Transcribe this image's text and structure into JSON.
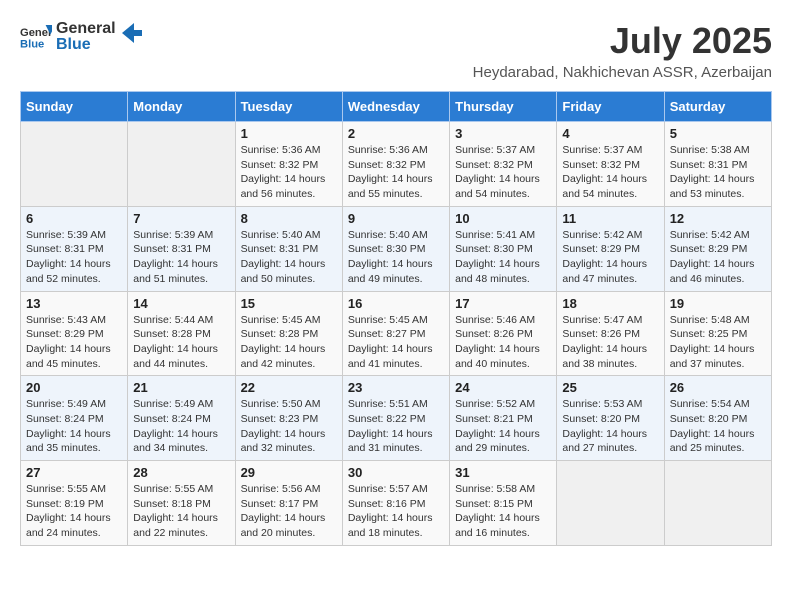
{
  "header": {
    "logo_general": "General",
    "logo_blue": "Blue",
    "month": "July 2025",
    "location": "Heydarabad, Nakhichevan ASSR, Azerbaijan"
  },
  "days_of_week": [
    "Sunday",
    "Monday",
    "Tuesday",
    "Wednesday",
    "Thursday",
    "Friday",
    "Saturday"
  ],
  "weeks": [
    [
      {
        "day": "",
        "info": ""
      },
      {
        "day": "",
        "info": ""
      },
      {
        "day": "1",
        "info": "Sunrise: 5:36 AM\nSunset: 8:32 PM\nDaylight: 14 hours and 56 minutes."
      },
      {
        "day": "2",
        "info": "Sunrise: 5:36 AM\nSunset: 8:32 PM\nDaylight: 14 hours and 55 minutes."
      },
      {
        "day": "3",
        "info": "Sunrise: 5:37 AM\nSunset: 8:32 PM\nDaylight: 14 hours and 54 minutes."
      },
      {
        "day": "4",
        "info": "Sunrise: 5:37 AM\nSunset: 8:32 PM\nDaylight: 14 hours and 54 minutes."
      },
      {
        "day": "5",
        "info": "Sunrise: 5:38 AM\nSunset: 8:31 PM\nDaylight: 14 hours and 53 minutes."
      }
    ],
    [
      {
        "day": "6",
        "info": "Sunrise: 5:39 AM\nSunset: 8:31 PM\nDaylight: 14 hours and 52 minutes."
      },
      {
        "day": "7",
        "info": "Sunrise: 5:39 AM\nSunset: 8:31 PM\nDaylight: 14 hours and 51 minutes."
      },
      {
        "day": "8",
        "info": "Sunrise: 5:40 AM\nSunset: 8:31 PM\nDaylight: 14 hours and 50 minutes."
      },
      {
        "day": "9",
        "info": "Sunrise: 5:40 AM\nSunset: 8:30 PM\nDaylight: 14 hours and 49 minutes."
      },
      {
        "day": "10",
        "info": "Sunrise: 5:41 AM\nSunset: 8:30 PM\nDaylight: 14 hours and 48 minutes."
      },
      {
        "day": "11",
        "info": "Sunrise: 5:42 AM\nSunset: 8:29 PM\nDaylight: 14 hours and 47 minutes."
      },
      {
        "day": "12",
        "info": "Sunrise: 5:42 AM\nSunset: 8:29 PM\nDaylight: 14 hours and 46 minutes."
      }
    ],
    [
      {
        "day": "13",
        "info": "Sunrise: 5:43 AM\nSunset: 8:29 PM\nDaylight: 14 hours and 45 minutes."
      },
      {
        "day": "14",
        "info": "Sunrise: 5:44 AM\nSunset: 8:28 PM\nDaylight: 14 hours and 44 minutes."
      },
      {
        "day": "15",
        "info": "Sunrise: 5:45 AM\nSunset: 8:28 PM\nDaylight: 14 hours and 42 minutes."
      },
      {
        "day": "16",
        "info": "Sunrise: 5:45 AM\nSunset: 8:27 PM\nDaylight: 14 hours and 41 minutes."
      },
      {
        "day": "17",
        "info": "Sunrise: 5:46 AM\nSunset: 8:26 PM\nDaylight: 14 hours and 40 minutes."
      },
      {
        "day": "18",
        "info": "Sunrise: 5:47 AM\nSunset: 8:26 PM\nDaylight: 14 hours and 38 minutes."
      },
      {
        "day": "19",
        "info": "Sunrise: 5:48 AM\nSunset: 8:25 PM\nDaylight: 14 hours and 37 minutes."
      }
    ],
    [
      {
        "day": "20",
        "info": "Sunrise: 5:49 AM\nSunset: 8:24 PM\nDaylight: 14 hours and 35 minutes."
      },
      {
        "day": "21",
        "info": "Sunrise: 5:49 AM\nSunset: 8:24 PM\nDaylight: 14 hours and 34 minutes."
      },
      {
        "day": "22",
        "info": "Sunrise: 5:50 AM\nSunset: 8:23 PM\nDaylight: 14 hours and 32 minutes."
      },
      {
        "day": "23",
        "info": "Sunrise: 5:51 AM\nSunset: 8:22 PM\nDaylight: 14 hours and 31 minutes."
      },
      {
        "day": "24",
        "info": "Sunrise: 5:52 AM\nSunset: 8:21 PM\nDaylight: 14 hours and 29 minutes."
      },
      {
        "day": "25",
        "info": "Sunrise: 5:53 AM\nSunset: 8:20 PM\nDaylight: 14 hours and 27 minutes."
      },
      {
        "day": "26",
        "info": "Sunrise: 5:54 AM\nSunset: 8:20 PM\nDaylight: 14 hours and 25 minutes."
      }
    ],
    [
      {
        "day": "27",
        "info": "Sunrise: 5:55 AM\nSunset: 8:19 PM\nDaylight: 14 hours and 24 minutes."
      },
      {
        "day": "28",
        "info": "Sunrise: 5:55 AM\nSunset: 8:18 PM\nDaylight: 14 hours and 22 minutes."
      },
      {
        "day": "29",
        "info": "Sunrise: 5:56 AM\nSunset: 8:17 PM\nDaylight: 14 hours and 20 minutes."
      },
      {
        "day": "30",
        "info": "Sunrise: 5:57 AM\nSunset: 8:16 PM\nDaylight: 14 hours and 18 minutes."
      },
      {
        "day": "31",
        "info": "Sunrise: 5:58 AM\nSunset: 8:15 PM\nDaylight: 14 hours and 16 minutes."
      },
      {
        "day": "",
        "info": ""
      },
      {
        "day": "",
        "info": ""
      }
    ]
  ],
  "colors": {
    "header_bg": "#2b7cd3",
    "logo_blue": "#1a6db5"
  }
}
